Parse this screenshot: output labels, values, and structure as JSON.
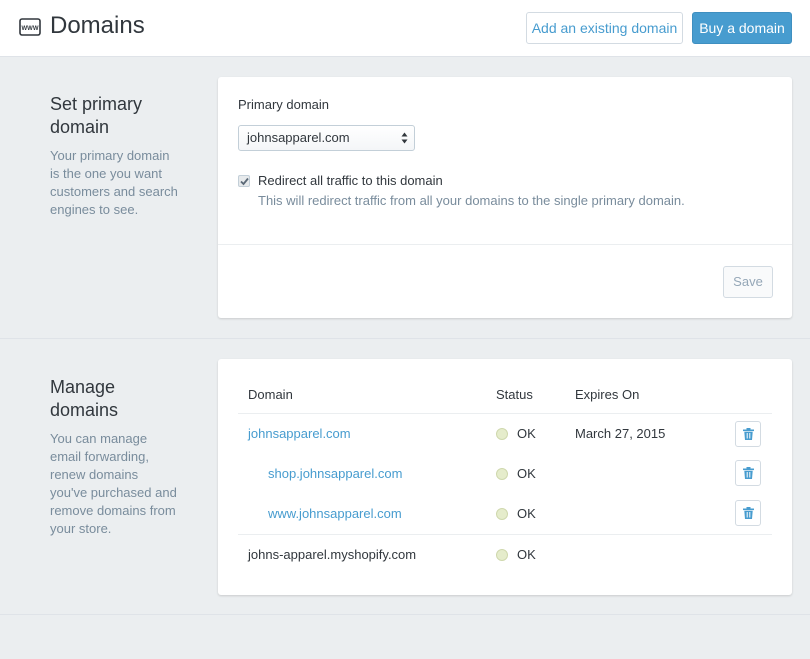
{
  "header": {
    "logo_icon": "www-icon",
    "title": "Domains",
    "add_existing_label": "Add an existing domain",
    "buy_label": "Buy a domain"
  },
  "primary_section": {
    "title": "Set primary domain",
    "description": "Your primary domain is the one you want customers and search engines to see.",
    "field_label": "Primary domain",
    "selected_domain": "johnsapparel.com",
    "redirect_checked": true,
    "redirect_label": "Redirect all traffic to this domain",
    "redirect_help": "This will redirect traffic from all your domains to the single primary domain.",
    "save_label": "Save"
  },
  "manage_section": {
    "title": "Manage domains",
    "description": "You can manage email forwarding, renew domains you've purchased and remove domains from your store.",
    "columns": [
      "Domain",
      "Status",
      "Expires On"
    ],
    "rows": [
      {
        "domain": "johnsapparel.com",
        "status": "OK",
        "expires": "March 27, 2015"
      },
      {
        "domain": "shop.johnsapparel.com",
        "status": "OK",
        "expires": ""
      },
      {
        "domain": "www.johnsapparel.com",
        "status": "OK",
        "expires": ""
      },
      {
        "domain": "johns-apparel.myshopify.com",
        "status": "OK",
        "expires": ""
      }
    ]
  },
  "colors": {
    "accent": "#479ccf",
    "status_ok": "#e5eccb"
  }
}
